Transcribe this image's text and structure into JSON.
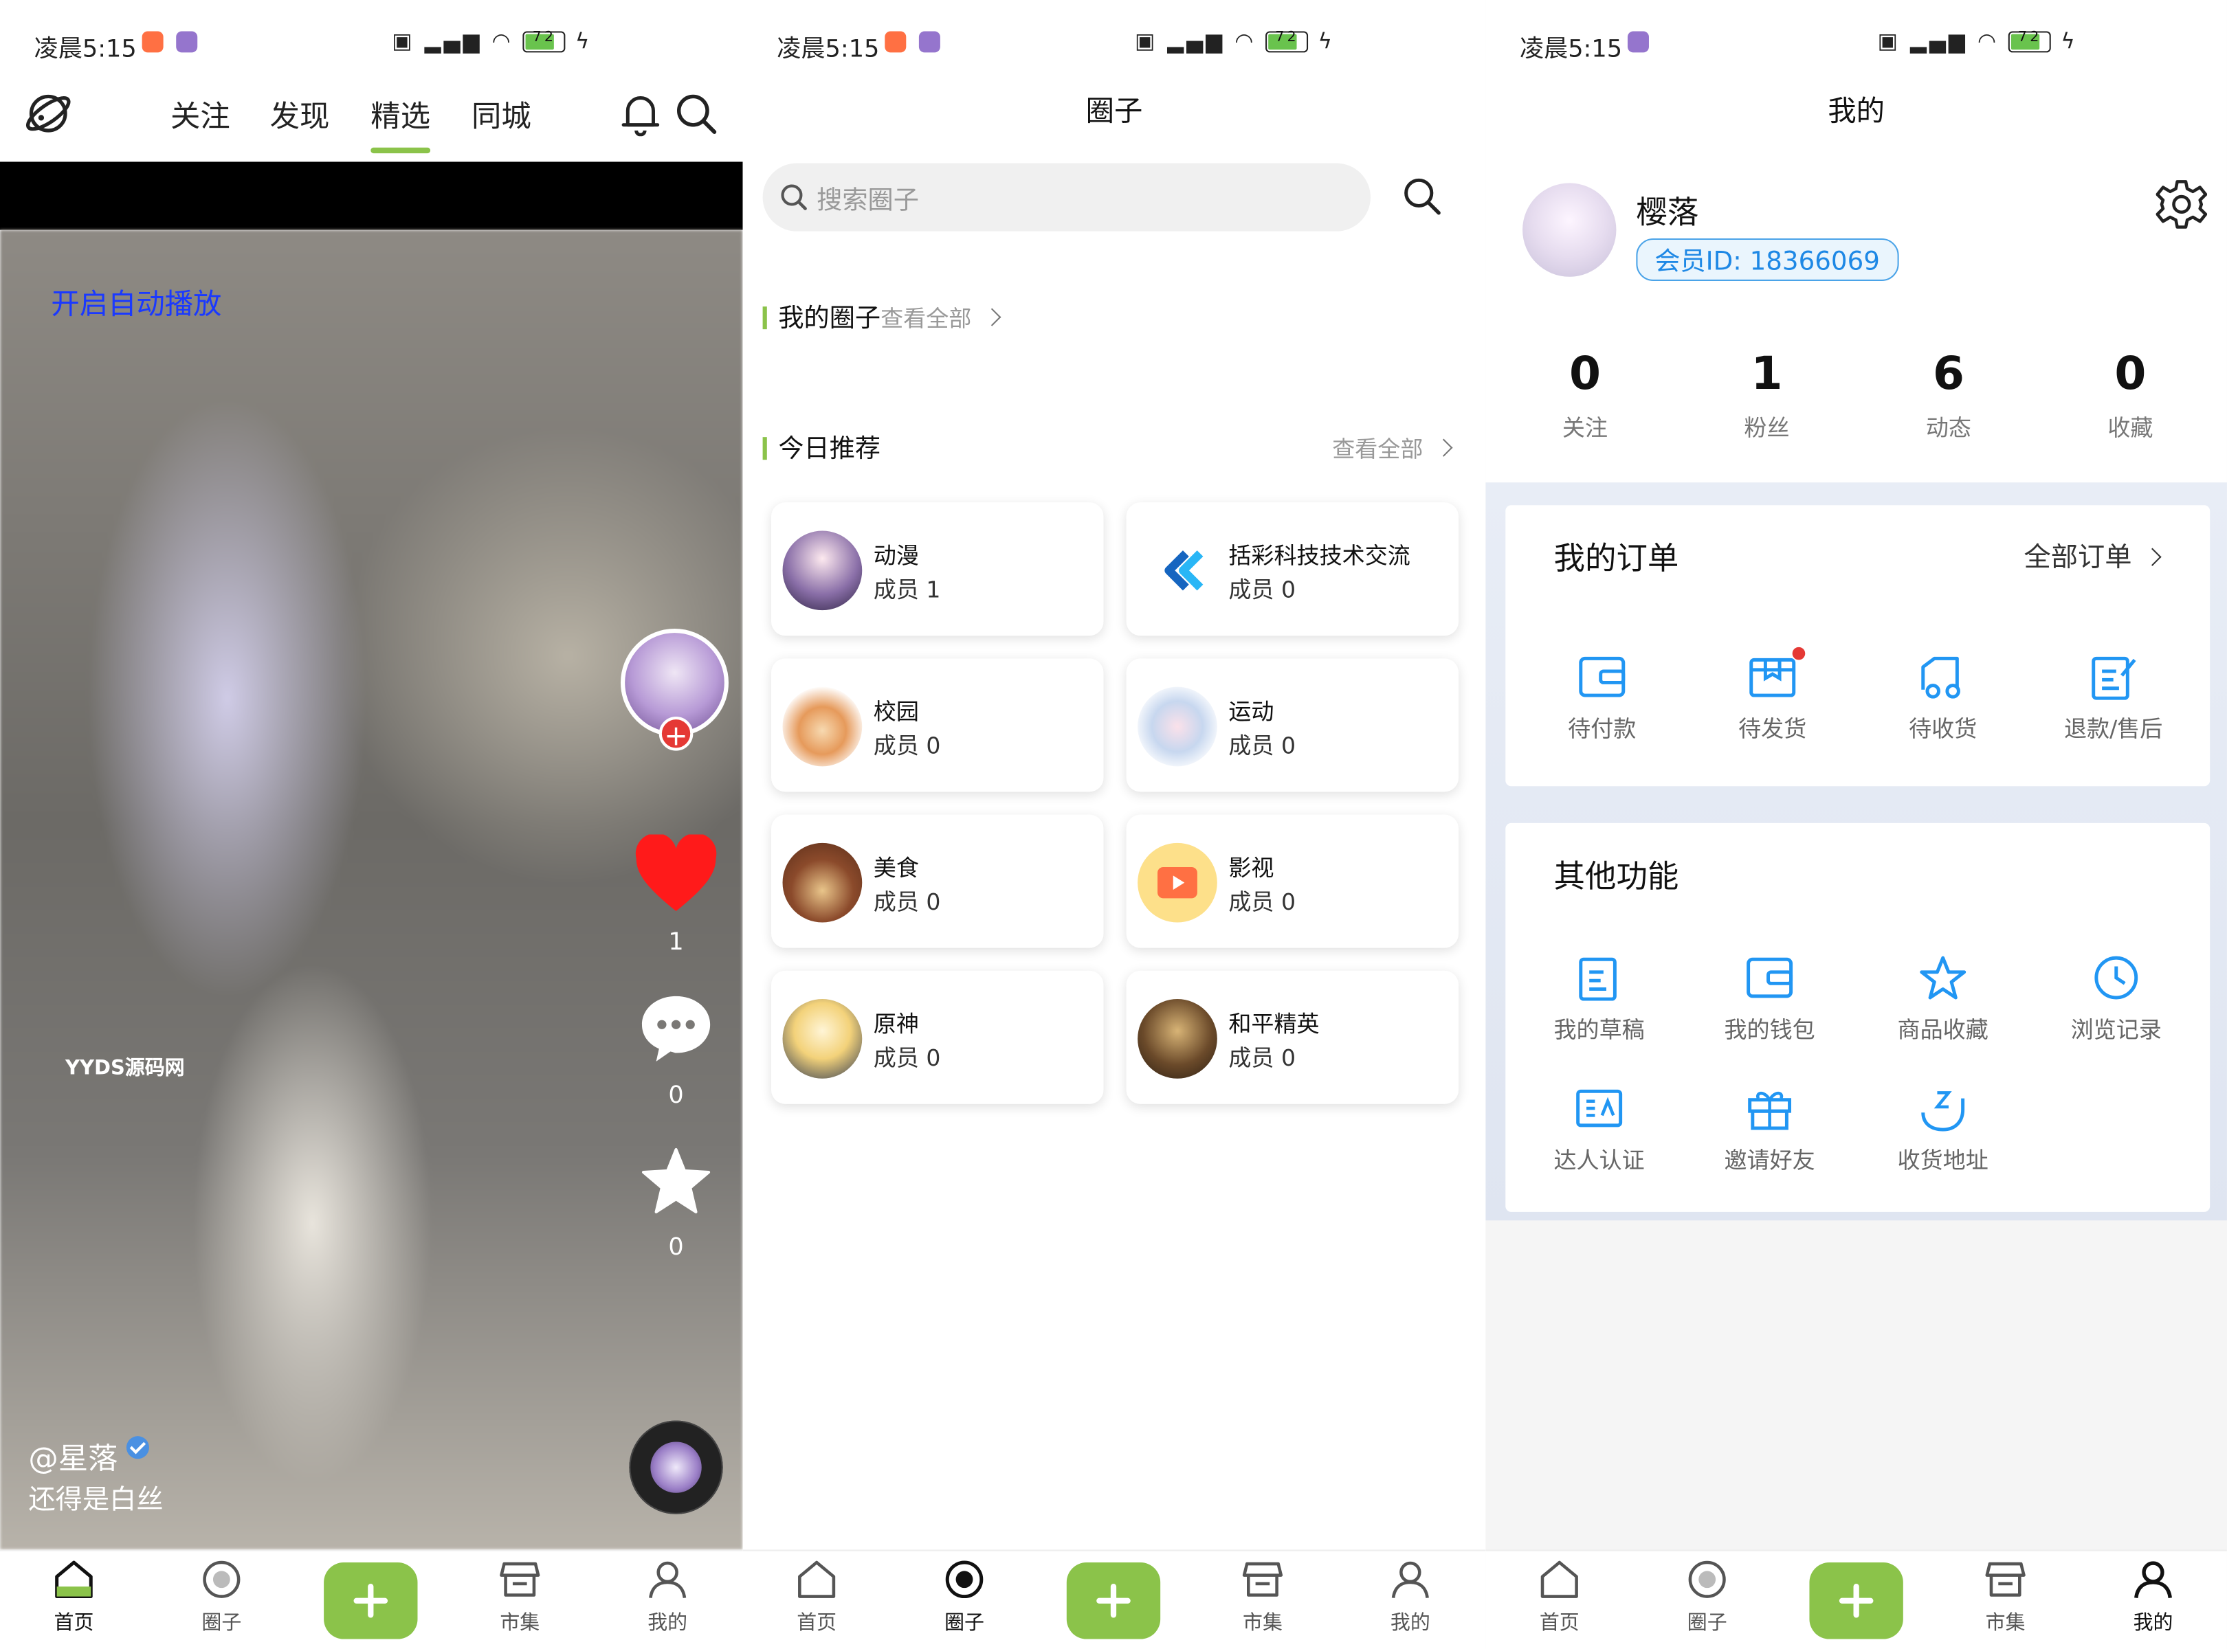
{
  "status_bar": {
    "time": "凌晨5:15",
    "battery": "72"
  },
  "feed": {
    "tabs": [
      "关注",
      "发现",
      "精选",
      "同城"
    ],
    "active_tab": "精选",
    "autoplay_label": "开启自动播放",
    "watermark": "YYDS源码网",
    "likes": "1",
    "comments": "0",
    "favorites": "0",
    "author": "@星落",
    "caption": "还得是白丝"
  },
  "circles": {
    "title": "圈子",
    "search_placeholder": "搜索圈子",
    "my_circles": "我的圈子",
    "my_circles_more": "查看全部",
    "today_rec": "今日推荐",
    "today_rec_more": "查看全部",
    "items": [
      {
        "name": "动漫",
        "members": "成员 1"
      },
      {
        "name": "括彩科技技术交流",
        "members": "成员 0"
      },
      {
        "name": "校园",
        "members": "成员 0"
      },
      {
        "name": "运动",
        "members": "成员 0"
      },
      {
        "name": "美食",
        "members": "成员 0"
      },
      {
        "name": "影视",
        "members": "成员 0"
      },
      {
        "name": "原神",
        "members": "成员 0"
      },
      {
        "name": "和平精英",
        "members": "成员 0"
      }
    ]
  },
  "profile": {
    "title": "我的",
    "name": "樱落",
    "member_id": "会员ID: 18366069",
    "stats": [
      {
        "n": "0",
        "l": "关注"
      },
      {
        "n": "1",
        "l": "粉丝"
      },
      {
        "n": "6",
        "l": "动态"
      },
      {
        "n": "0",
        "l": "收藏"
      }
    ],
    "orders_title": "我的订单",
    "orders_more": "全部订单",
    "orders": [
      "待付款",
      "待发货",
      "待收货",
      "退款/售后"
    ],
    "other_title": "其他功能",
    "other": [
      "我的草稿",
      "我的钱包",
      "商品收藏",
      "浏览记录",
      "达人认证",
      "邀请好友",
      "收货地址"
    ]
  },
  "bottom_nav": [
    "首页",
    "圈子",
    "市集",
    "我的"
  ],
  "colors": {
    "accent": "#8bc34a",
    "like": "#ff1a1a",
    "link_blue": "#1a39ff",
    "member_blue": "#1e88e5"
  }
}
